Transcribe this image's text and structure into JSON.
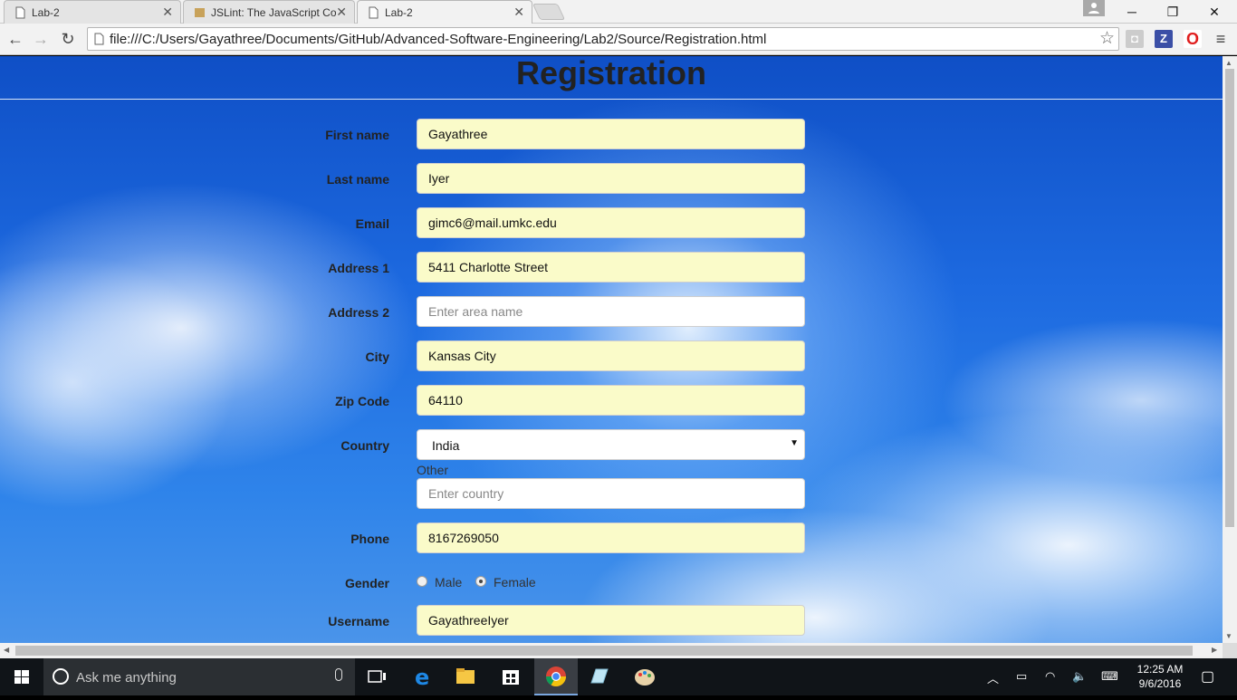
{
  "browser": {
    "tabs": [
      {
        "title": "Lab-2",
        "active": false
      },
      {
        "title": "JSLint: The JavaScript Code",
        "active": false
      },
      {
        "title": "Lab-2",
        "active": true
      }
    ],
    "url": "file:///C:/Users/Gayathree/Documents/GitHub/Advanced-Software-Engineering/Lab2/Source/Registration.html"
  },
  "page": {
    "title": "Registration",
    "form": {
      "first_name": {
        "label": "First name",
        "value": "Gayathree"
      },
      "last_name": {
        "label": "Last name",
        "value": "Iyer"
      },
      "email": {
        "label": "Email",
        "value": "gimc6@mail.umkc.edu"
      },
      "address1": {
        "label": "Address 1",
        "value": "5411 Charlotte Street"
      },
      "address2": {
        "label": "Address 2",
        "value": "",
        "placeholder": "Enter area name"
      },
      "city": {
        "label": "City",
        "value": "Kansas City"
      },
      "zip": {
        "label": "Zip Code",
        "value": "64110"
      },
      "country": {
        "label": "Country",
        "value": "India",
        "other_label": "Other",
        "other_placeholder": "Enter country"
      },
      "phone": {
        "label": "Phone",
        "value": "8167269050"
      },
      "gender": {
        "label": "Gender",
        "options": [
          "Male",
          "Female"
        ],
        "selected": "Female"
      },
      "username": {
        "label": "Username",
        "value": "GayathreeIyer"
      }
    }
  },
  "taskbar": {
    "search_placeholder": "Ask me anything",
    "time": "12:25 AM",
    "date": "9/6/2016"
  },
  "colors": {
    "autofill_bg": "#fafbc9",
    "sky_top": "#0f4fc6"
  }
}
